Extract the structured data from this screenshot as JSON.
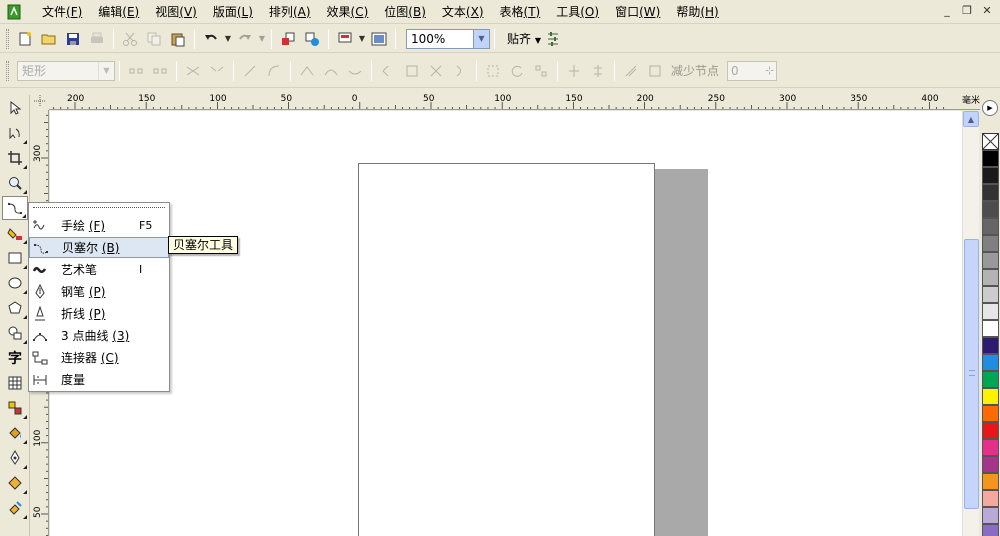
{
  "menubar": {
    "items": [
      {
        "label": "文件",
        "key": "(F)"
      },
      {
        "label": "编辑",
        "key": "(E)"
      },
      {
        "label": "视图",
        "key": "(V)"
      },
      {
        "label": "版面",
        "key": "(L)"
      },
      {
        "label": "排列",
        "key": "(A)"
      },
      {
        "label": "效果",
        "key": "(C)"
      },
      {
        "label": "位图",
        "key": "(B)"
      },
      {
        "label": "文本",
        "key": "(X)"
      },
      {
        "label": "表格",
        "key": "(T)"
      },
      {
        "label": "工具",
        "key": "(O)"
      },
      {
        "label": "窗口",
        "key": "(W)"
      },
      {
        "label": "帮助",
        "key": "(H)"
      }
    ],
    "window_controls": {
      "minimize": "_",
      "restore": "❐",
      "close": "✕"
    }
  },
  "toolbar": {
    "zoom_value": "100%",
    "snap_label": "贴齐"
  },
  "propertybar": {
    "object_type": "矩形",
    "reduce_nodes_label": "减少节点",
    "reduce_nodes_value": "0"
  },
  "ruler": {
    "unit": "毫米",
    "h_labels": [
      "200",
      "150",
      "100",
      "50",
      "0",
      "50",
      "100",
      "150",
      "200",
      "250",
      "300",
      "350",
      "400"
    ],
    "v_labels": [
      "300",
      "250",
      "200",
      "150",
      "100",
      "50"
    ]
  },
  "flyout": {
    "items": [
      {
        "label": "手绘",
        "key": "(F)",
        "shortcut": "F5",
        "icon": "freehand-icon"
      },
      {
        "label": "贝塞尔",
        "key": "(B)",
        "shortcut": "",
        "icon": "bezier-icon"
      },
      {
        "label": "艺术笔",
        "key": "",
        "shortcut": "I",
        "icon": "artistic-media-icon"
      },
      {
        "label": "钢笔",
        "key": "(P)",
        "shortcut": "",
        "icon": "pen-icon"
      },
      {
        "label": "折线",
        "key": "(P)",
        "shortcut": "",
        "icon": "polyline-icon"
      },
      {
        "label": "3 点曲线",
        "key": "(3)",
        "shortcut": "",
        "icon": "three-point-curve-icon"
      },
      {
        "label": "连接器",
        "key": "(C)",
        "shortcut": "",
        "icon": "connector-icon"
      },
      {
        "label": "度量",
        "key": "",
        "shortcut": "",
        "icon": "dimension-icon"
      }
    ]
  },
  "tooltip": {
    "text": "贝塞尔工具"
  },
  "palette": {
    "colors": [
      "#000000",
      "#1a1a1a",
      "#333333",
      "#4d4d4d",
      "#666666",
      "#808080",
      "#999999",
      "#b3b3b3",
      "#cccccc",
      "#e6e6e6",
      "#ffffff",
      "#2e1a6e",
      "#1e8fe0",
      "#00a651",
      "#fff200",
      "#ff6a00",
      "#e8151b",
      "#e62e8a",
      "#a3358c",
      "#f7941d",
      "#f4a9a0",
      "#b9a9d9",
      "#8a6cc4"
    ]
  }
}
